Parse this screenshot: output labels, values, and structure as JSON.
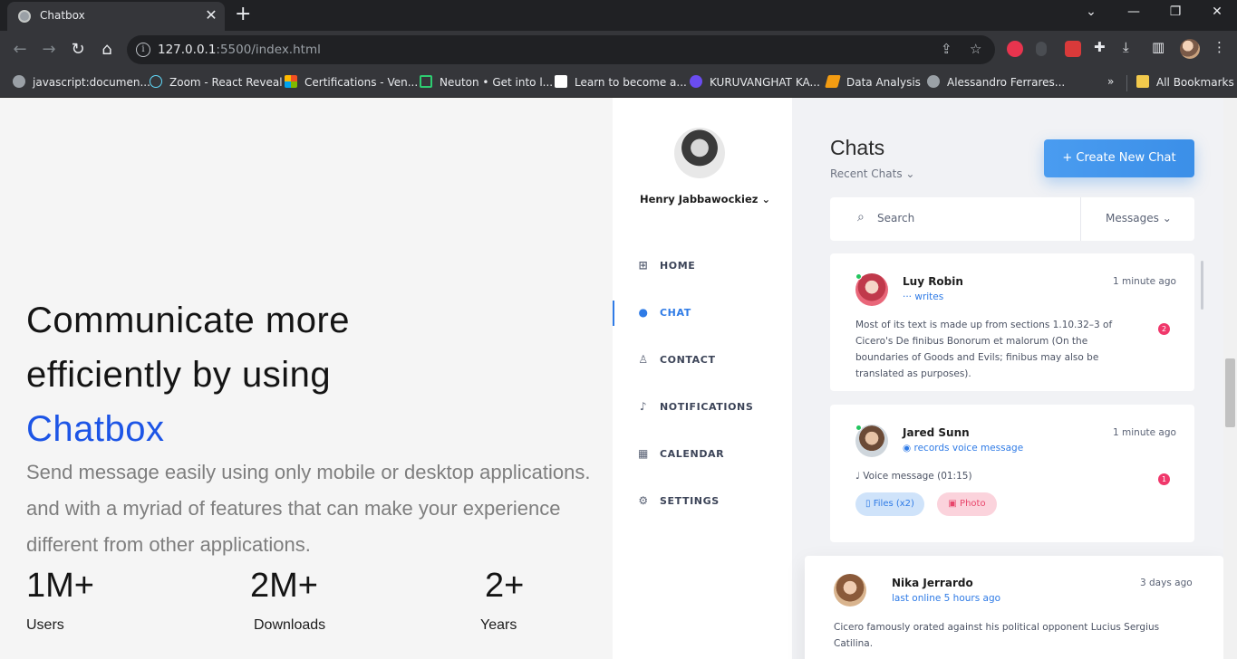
{
  "browser": {
    "tab_title": "Chatbox",
    "tab_close": "✕",
    "new_tab": "+",
    "url_host": "127.0.0.1",
    "url_rest": ":5500/index.html",
    "bookmarks": [
      "javascript:documen...",
      "Zoom - React Reveal",
      "Certifications - Ven...",
      "Neuton • Get into l...",
      "Learn to become a...",
      "KURUVANGHAT KA...",
      "Data Analysis",
      "Alessandro Ferrares..."
    ],
    "overflow": "»",
    "all_bookmarks": "All Bookmarks"
  },
  "hero": {
    "line1": "Communicate more",
    "line2": "efficiently by using",
    "brand": "Chatbox",
    "subtitle": "Send message easily using only mobile or desktop applications. and with a myriad of features that can make your experience different from other applications.",
    "stats": [
      {
        "value": "1M+",
        "label": "Users"
      },
      {
        "value": "2M+",
        "label": "Downloads"
      },
      {
        "value": "2+",
        "label": "Years"
      }
    ]
  },
  "app": {
    "user_name": "Henry Jabbawockiez",
    "nav": [
      {
        "label": "HOME",
        "icon": "grid-icon"
      },
      {
        "label": "CHAT",
        "icon": "chat-bubble-icon"
      },
      {
        "label": "CONTACT",
        "icon": "person-icon"
      },
      {
        "label": "NOTIFICATIONS",
        "icon": "bell-icon"
      },
      {
        "label": "CALENDAR",
        "icon": "calendar-icon"
      },
      {
        "label": "SETTINGS",
        "icon": "gear-icon"
      }
    ],
    "chats_title": "Chats",
    "recent_chats": "Recent Chats",
    "create_button": "+ Create New Chat",
    "search_placeholder": "Search",
    "messages_filter": "Messages",
    "chats": [
      {
        "name": "Luy Robin",
        "status": "writes",
        "time": "1 minute ago",
        "text": "Most of its text is made up from sections 1.10.32–3 of Cicero's De finibus Bonorum et malorum (On the boundaries of Goods and Evils; finibus may also be translated as purposes).",
        "badge": "2"
      },
      {
        "name": "Jared Sunn",
        "status": "records voice message",
        "time": "1 minute ago",
        "text": "Voice message (01:15)",
        "badge": "1",
        "attachments": [
          "Files (x2)",
          "Photo"
        ]
      },
      {
        "name": "Nika Jerrardo",
        "status": "last online 5 hours ago",
        "time": "3 days ago",
        "text": "Cicero famously orated against his political opponent Lucius Sergius Catilina."
      }
    ]
  },
  "colors": {
    "brand_blue": "#1d55e6",
    "accent_blue": "#2f7be6",
    "badge_pink": "#f0386b",
    "online_green": "#22c55e"
  }
}
